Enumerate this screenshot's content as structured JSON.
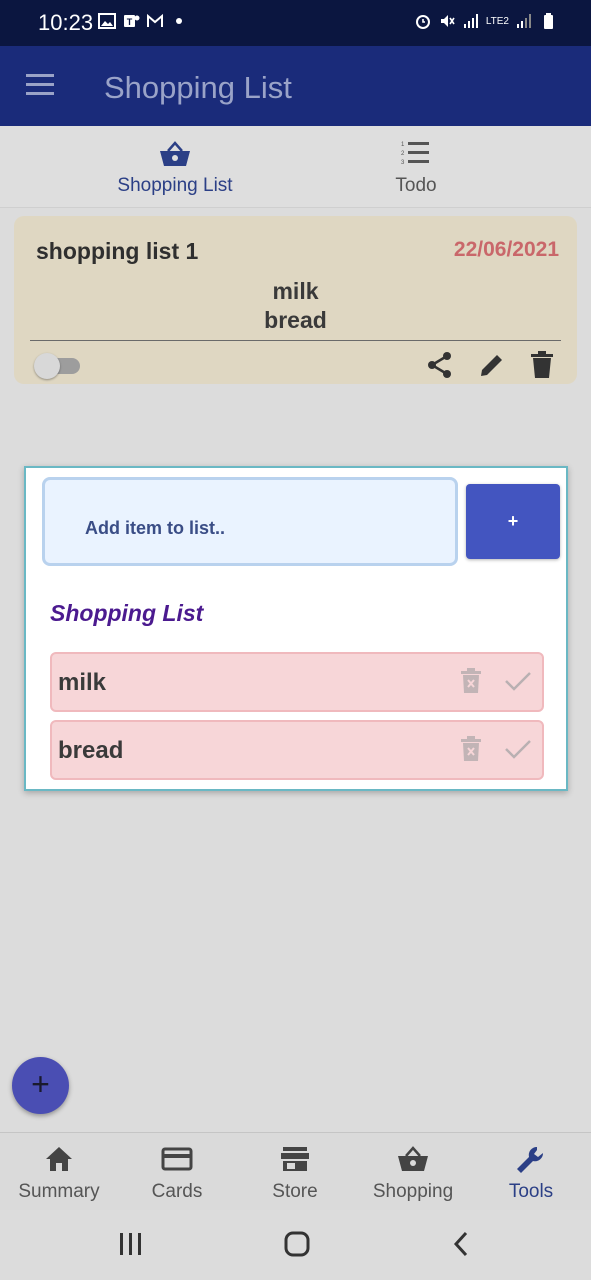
{
  "status_bar": {
    "time": "10:23",
    "network": "LTE2"
  },
  "app_bar": {
    "title": "Shopping List"
  },
  "tabs": [
    {
      "label": "Shopping List",
      "icon": "basket-icon",
      "active": true
    },
    {
      "label": "Todo",
      "icon": "numbered-list-icon",
      "active": false
    }
  ],
  "card": {
    "title": "shopping list 1",
    "date": "22/06/2021",
    "items": [
      "milk",
      "bread"
    ]
  },
  "dialog": {
    "input_placeholder": "Add item to list..",
    "add_label": "+",
    "heading": "Shopping List",
    "items": [
      {
        "label": "milk"
      },
      {
        "label": "bread"
      }
    ]
  },
  "fab": {
    "label": "+"
  },
  "bottom_nav": [
    {
      "label": "Summary",
      "icon": "home-icon",
      "active": false
    },
    {
      "label": "Cards",
      "icon": "card-icon",
      "active": false
    },
    {
      "label": "Store",
      "icon": "store-icon",
      "active": false
    },
    {
      "label": "Shopping",
      "icon": "basket-icon",
      "active": false
    },
    {
      "label": "Tools",
      "icon": "wrench-icon",
      "active": true
    }
  ],
  "colors": {
    "app_bar": "#1a2b7a",
    "accent": "#2b3f86",
    "date": "#c9676a",
    "dialog_heading": "#4b1a8f",
    "add_button": "#4355c0",
    "list_row": "#f7d6d8"
  }
}
